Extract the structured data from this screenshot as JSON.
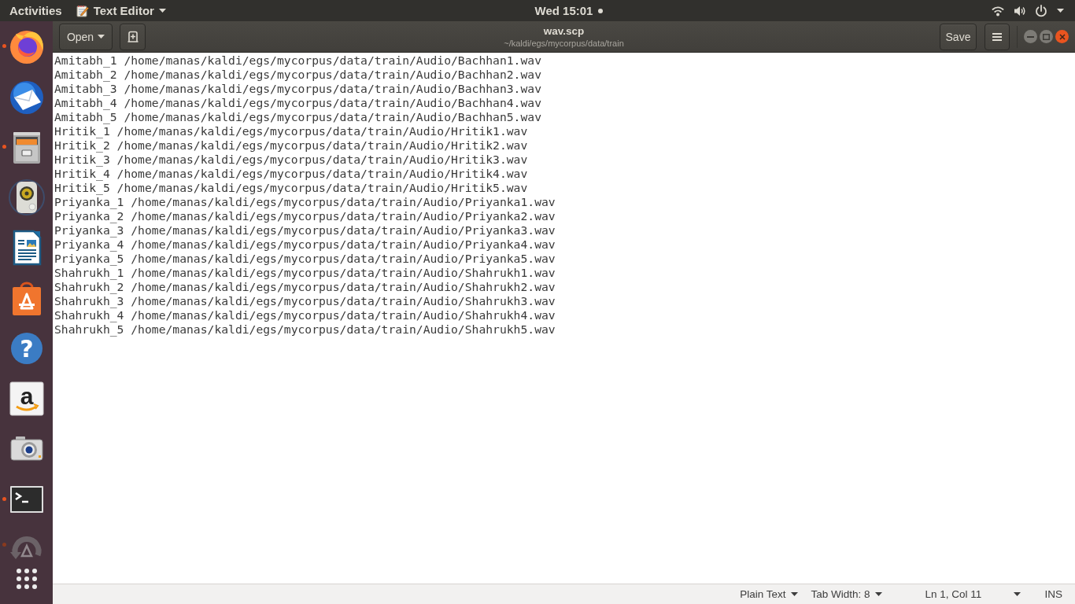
{
  "top_bar": {
    "activities": "Activities",
    "app_menu": "Text Editor",
    "clock": "Wed 15:01"
  },
  "dock": {
    "items": [
      {
        "kind": "browser",
        "running": true,
        "faded": false
      },
      {
        "kind": "mail",
        "running": false,
        "faded": false
      },
      {
        "kind": "files",
        "running": true,
        "faded": false
      },
      {
        "kind": "music",
        "running": false,
        "faded": false
      },
      {
        "kind": "document",
        "running": false,
        "faded": false
      },
      {
        "kind": "software",
        "running": false,
        "faded": false
      },
      {
        "kind": "help",
        "glyph": "?",
        "running": false,
        "faded": false
      },
      {
        "kind": "store",
        "glyph": "a",
        "running": false,
        "faded": false
      },
      {
        "kind": "camera",
        "running": false,
        "faded": false
      },
      {
        "kind": "terminal",
        "running": true,
        "faded": false
      },
      {
        "kind": "updater",
        "running": true,
        "faded": true
      }
    ]
  },
  "window": {
    "open_button": "Open",
    "title": "wav.scp",
    "subtitle": "~/kaldi/egs/mycorpus/data/train",
    "save_button": "Save"
  },
  "editor": {
    "lines": [
      "Amitabh_1 /home/manas/kaldi/egs/mycorpus/data/train/Audio/Bachhan1.wav",
      "Amitabh_2 /home/manas/kaldi/egs/mycorpus/data/train/Audio/Bachhan2.wav",
      "Amitabh_3 /home/manas/kaldi/egs/mycorpus/data/train/Audio/Bachhan3.wav",
      "Amitabh_4 /home/manas/kaldi/egs/mycorpus/data/train/Audio/Bachhan4.wav",
      "Amitabh_5 /home/manas/kaldi/egs/mycorpus/data/train/Audio/Bachhan5.wav",
      "Hritik_1 /home/manas/kaldi/egs/mycorpus/data/train/Audio/Hritik1.wav",
      "Hritik_2 /home/manas/kaldi/egs/mycorpus/data/train/Audio/Hritik2.wav",
      "Hritik_3 /home/manas/kaldi/egs/mycorpus/data/train/Audio/Hritik3.wav",
      "Hritik_4 /home/manas/kaldi/egs/mycorpus/data/train/Audio/Hritik4.wav",
      "Hritik_5 /home/manas/kaldi/egs/mycorpus/data/train/Audio/Hritik5.wav",
      "Priyanka_1 /home/manas/kaldi/egs/mycorpus/data/train/Audio/Priyanka1.wav",
      "Priyanka_2 /home/manas/kaldi/egs/mycorpus/data/train/Audio/Priyanka2.wav",
      "Priyanka_3 /home/manas/kaldi/egs/mycorpus/data/train/Audio/Priyanka3.wav",
      "Priyanka_4 /home/manas/kaldi/egs/mycorpus/data/train/Audio/Priyanka4.wav",
      "Priyanka_5 /home/manas/kaldi/egs/mycorpus/data/train/Audio/Priyanka5.wav",
      "Shahrukh_1 /home/manas/kaldi/egs/mycorpus/data/train/Audio/Shahrukh1.wav",
      "Shahrukh_2 /home/manas/kaldi/egs/mycorpus/data/train/Audio/Shahrukh2.wav",
      "Shahrukh_3 /home/manas/kaldi/egs/mycorpus/data/train/Audio/Shahrukh3.wav",
      "Shahrukh_4 /home/manas/kaldi/egs/mycorpus/data/train/Audio/Shahrukh4.wav",
      "Shahrukh_5 /home/manas/kaldi/egs/mycorpus/data/train/Audio/Shahrukh5.wav"
    ]
  },
  "status_bar": {
    "language": "Plain Text",
    "tab_width": "Tab Width: 8",
    "position": "Ln 1, Col 11",
    "mode": "INS"
  }
}
